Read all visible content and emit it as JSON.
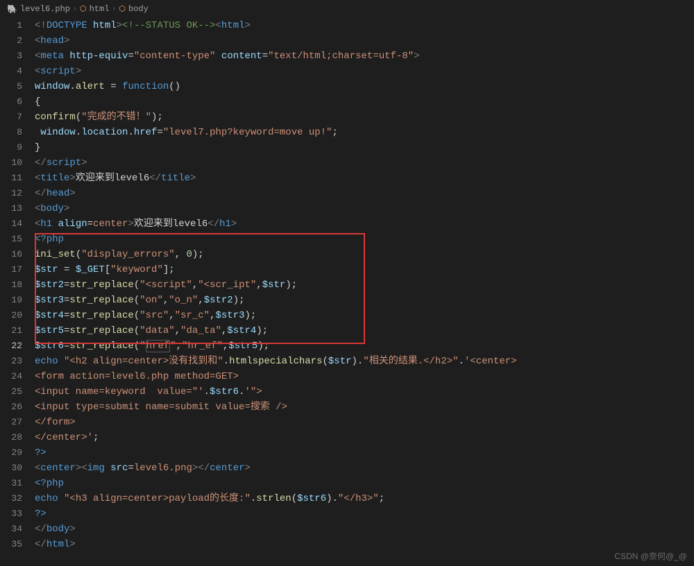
{
  "breadcrumb": {
    "file": "level6.php",
    "path1": "html",
    "path2": "body"
  },
  "lines": [
    "1",
    "2",
    "3",
    "4",
    "5",
    "6",
    "7",
    "8",
    "9",
    "10",
    "11",
    "12",
    "13",
    "14",
    "15",
    "16",
    "17",
    "18",
    "19",
    "20",
    "21",
    "22",
    "23",
    "24",
    "25",
    "26",
    "27",
    "28",
    "29",
    "30",
    "31",
    "32",
    "33",
    "34",
    "35"
  ],
  "activeLine": "22",
  "code": {
    "l1": {
      "t1": "<!",
      "t2": "DOCTYPE",
      "t3": " ",
      "t4": "html",
      "t5": ">",
      "t6": "<!--STATUS OK-->",
      "t7": "<",
      "t8": "html",
      "t9": ">"
    },
    "l2": {
      "t1": "<",
      "t2": "head",
      "t3": ">"
    },
    "l3": {
      "t1": "<",
      "t2": "meta",
      "t3": " ",
      "t4": "http-equiv",
      "t5": "=",
      "t6": "\"content-type\"",
      "t7": " ",
      "t8": "content",
      "t9": "=",
      "t10": "\"text/html;charset=utf-8\"",
      "t11": ">"
    },
    "l4": {
      "t1": "<",
      "t2": "script",
      "t3": ">"
    },
    "l5": {
      "t1": "window",
      "t2": ".",
      "t3": "alert",
      "t4": " = ",
      "t5": "function",
      "t6": "()"
    },
    "l6": {
      "t1": "{"
    },
    "l7": {
      "t1": "confirm",
      "t2": "(",
      "t3": "\"完成的不错！\"",
      "t4": ");"
    },
    "l8": {
      "t1": " window",
      "t2": ".",
      "t3": "location",
      "t4": ".",
      "t5": "href",
      "t6": "=",
      "t7": "\"level7.php?keyword=move up!\"",
      "t8": ";"
    },
    "l9": {
      "t1": "}"
    },
    "l10": {
      "t1": "</",
      "t2": "script",
      "t3": ">"
    },
    "l11": {
      "t1": "<",
      "t2": "title",
      "t3": ">",
      "t4": "欢迎来到level6",
      "t5": "</",
      "t6": "title",
      "t7": ">"
    },
    "l12": {
      "t1": "</",
      "t2": "head",
      "t3": ">"
    },
    "l13": {
      "t1": "<",
      "t2": "body",
      "t3": ">"
    },
    "l14": {
      "t1": "<",
      "t2": "h1",
      "t3": " ",
      "t4": "align",
      "t5": "=",
      "t6": "center",
      "t7": ">",
      "t8": "欢迎来到level6",
      "t9": "</",
      "t10": "h1",
      "t11": ">"
    },
    "l15": {
      "t1": "<?php"
    },
    "l16": {
      "t1": "ini_set",
      "t2": "(",
      "t3": "\"display_errors\"",
      "t4": ", ",
      "t5": "0",
      "t6": ");"
    },
    "l17": {
      "t1": "$str",
      "t2": " = ",
      "t3": "$_GET",
      "t4": "[",
      "t5": "\"keyword\"",
      "t6": "];"
    },
    "l18": {
      "t1": "$str2",
      "t2": "=",
      "t3": "str_replace",
      "t4": "(",
      "t5": "\"<script\"",
      "t6": ",",
      "t7": "\"<scr_ipt\"",
      "t8": ",",
      "t9": "$str",
      "t10": ");"
    },
    "l19": {
      "t1": "$str3",
      "t2": "=",
      "t3": "str_replace",
      "t4": "(",
      "t5": "\"on\"",
      "t6": ",",
      "t7": "\"o_n\"",
      "t8": ",",
      "t9": "$str2",
      "t10": ");"
    },
    "l20": {
      "t1": "$str4",
      "t2": "=",
      "t3": "str_replace",
      "t4": "(",
      "t5": "\"src\"",
      "t6": ",",
      "t7": "\"sr_c\"",
      "t8": ",",
      "t9": "$str3",
      "t10": ");"
    },
    "l21": {
      "t1": "$str5",
      "t2": "=",
      "t3": "str_replace",
      "t4": "(",
      "t5": "\"data\"",
      "t6": ",",
      "t7": "\"da_ta\"",
      "t8": ",",
      "t9": "$str4",
      "t10": ");"
    },
    "l22": {
      "t1": "$str6",
      "t2": "=",
      "t3": "str_replace",
      "t4": "(",
      "t5": "\"",
      "t5b": "href",
      "t5c": "\"",
      "t6": ",",
      "t7": "\"hr_ef\"",
      "t8": ",",
      "t9": "$str5",
      "t10": ");"
    },
    "l23": {
      "t1": "echo",
      "t2": " ",
      "t3": "\"<h2 align=center>没有找到和\"",
      "t4": ".",
      "t5": "htmlspecialchars",
      "t6": "(",
      "t7": "$str",
      "t8": ").",
      "t9": "\"相关的结果.</h2>\"",
      "t10": ".",
      "t11": "'<center>"
    },
    "l24": {
      "t1": "<form action=level6.php method=GET>"
    },
    "l25": {
      "t1": "<input name=keyword  value=\"'",
      "t2": ".",
      "t3": "$str6",
      "t4": ".",
      "t5": "'\">"
    },
    "l26": {
      "t1": "<input type=submit name=submit value=搜索 />"
    },
    "l27": {
      "t1": "</form>"
    },
    "l28": {
      "t1": "</center>'",
      "t2": ";"
    },
    "l29": {
      "t1": "?>"
    },
    "l30": {
      "t1": "<",
      "t2": "center",
      "t3": "><",
      "t4": "img",
      "t5": " ",
      "t6": "src",
      "t7": "=",
      "t8": "level6.png",
      "t9": "></",
      "t10": "center",
      "t11": ">"
    },
    "l31": {
      "t1": "<?php"
    },
    "l32": {
      "t1": "echo",
      "t2": " ",
      "t3": "\"<h3 align=center>payload的长度:\"",
      "t4": ".",
      "t5": "strlen",
      "t6": "(",
      "t7": "$str6",
      "t8": ").",
      "t9": "\"</h3>\"",
      "t10": ";"
    },
    "l33": {
      "t1": "?>"
    },
    "l34": {
      "t1": "</",
      "t2": "body",
      "t3": ">"
    },
    "l35": {
      "t1": "</",
      "t2": "html",
      "t3": ">"
    }
  },
  "watermark": "CSDN @奈何@_@"
}
